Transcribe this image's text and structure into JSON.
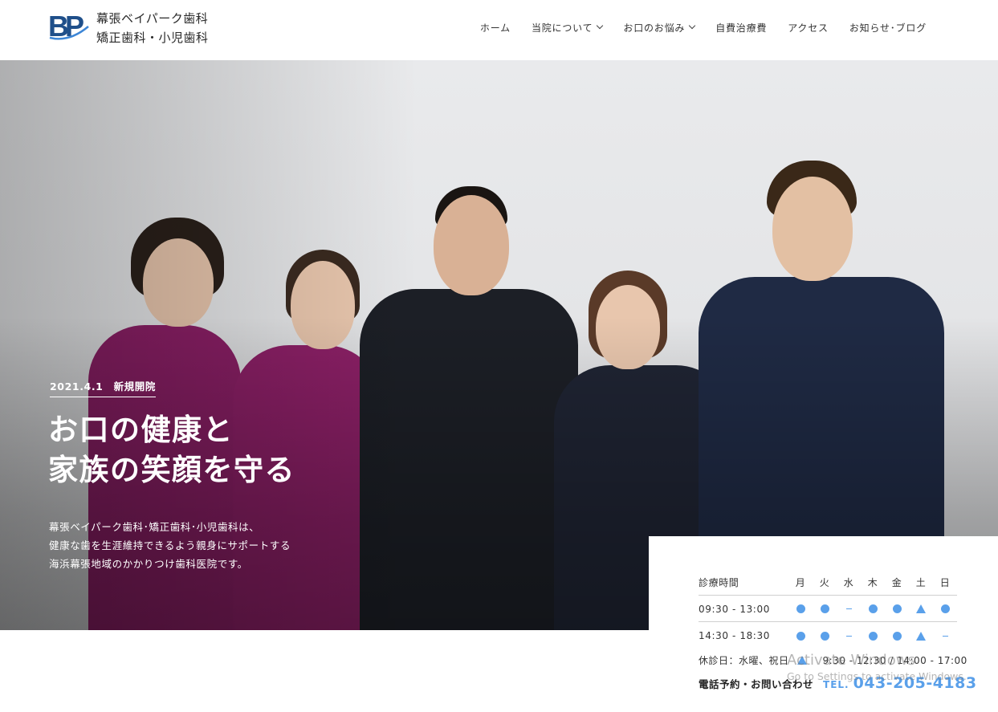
{
  "header": {
    "logo_mark": "BP",
    "logo_line1": "幕張ベイパーク歯科",
    "logo_line2": "矯正歯科・小児歯科",
    "nav": [
      {
        "label": "ホーム",
        "dropdown": false
      },
      {
        "label": "当院について",
        "dropdown": true
      },
      {
        "label": "お口のお悩み",
        "dropdown": true
      },
      {
        "label": "自費治療費",
        "dropdown": false
      },
      {
        "label": "アクセス",
        "dropdown": false
      },
      {
        "label": "お知らせ･ブログ",
        "dropdown": false
      }
    ]
  },
  "hero": {
    "date": "2021.4.1　新規開院",
    "title_line1": "お口の健康と",
    "title_line2": "家族の笑顔を守る",
    "desc_line1": "幕張ベイパーク歯科･矯正歯科･小児歯科は、",
    "desc_line2": "健康な歯を生涯維持できるよう親身にサポートする",
    "desc_line3": "海浜幕張地域のかかりつけ歯科医院です。"
  },
  "hours": {
    "label": "診療時間",
    "days": [
      "月",
      "火",
      "水",
      "木",
      "金",
      "土",
      "日"
    ],
    "rows": [
      {
        "time": "09:30 - 13:00",
        "marks": [
          "dot",
          "dot",
          "dash",
          "dot",
          "dot",
          "tri",
          "dot"
        ]
      },
      {
        "time": "14:30 - 18:30",
        "marks": [
          "dot",
          "dot",
          "dash",
          "dot",
          "dot",
          "tri",
          "dash"
        ]
      }
    ],
    "closed": "休診日：水曜、祝日",
    "tri_note": "9:30 - 12:30 / 14:00 - 17:00",
    "phone_label": "電話予約・お問い合わせ",
    "tel_prefix": "TEL.",
    "phone": "043-205-4183"
  },
  "watermark": {
    "line1": "Activate Windows",
    "line2": "Go to Settings to activate Windows."
  },
  "colors": {
    "accent": "#5aa0ea",
    "logo": "#1f4f8a",
    "scrub_magenta": "#8b1f66",
    "scrub_navy": "#1f2a44",
    "scrub_black": "#1c1f26"
  }
}
